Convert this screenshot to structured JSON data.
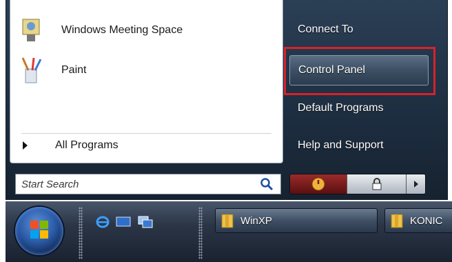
{
  "start_menu": {
    "programs": [
      {
        "label": "Windows Meeting Space",
        "icon": "meeting-space-icon"
      },
      {
        "label": "Paint",
        "icon": "paint-icon"
      }
    ],
    "all_programs_label": "All Programs",
    "search_placeholder": "Start Search",
    "right_items": {
      "connect_to": "Connect To",
      "control_panel": "Control Panel",
      "default_programs": "Default Programs",
      "help_and_support": "Help and Support"
    },
    "power": {
      "power_icon": "power-icon",
      "lock_icon": "lock-icon",
      "arrow_icon": "arrow-right-icon"
    },
    "highlight_color": "#d8222a"
  },
  "taskbar": {
    "quick_launch": [
      "internet-explorer-icon",
      "show-desktop-icon",
      "switch-windows-icon"
    ],
    "buttons": [
      {
        "label": "WinXP",
        "icon": "folder-icon"
      },
      {
        "label": "KONIC",
        "icon": "folder-icon"
      }
    ]
  }
}
